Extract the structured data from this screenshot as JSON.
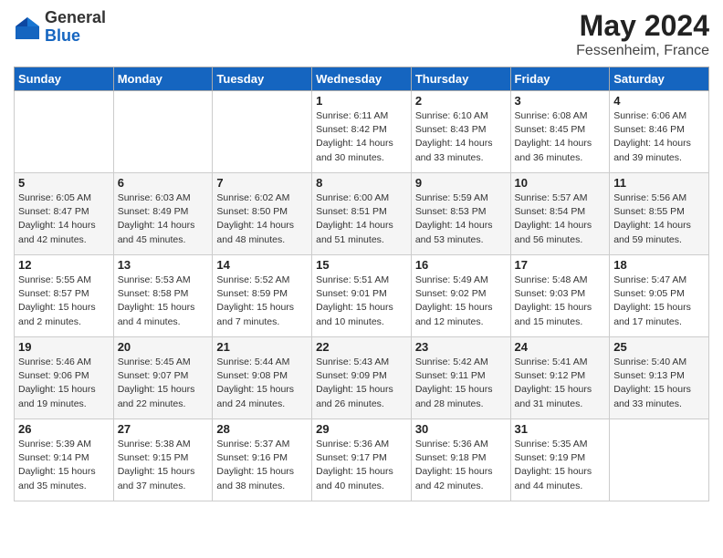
{
  "header": {
    "logo_general": "General",
    "logo_blue": "Blue",
    "month_year": "May 2024",
    "location": "Fessenheim, France"
  },
  "days_of_week": [
    "Sunday",
    "Monday",
    "Tuesday",
    "Wednesday",
    "Thursday",
    "Friday",
    "Saturday"
  ],
  "weeks": [
    [
      {
        "day": "",
        "info": ""
      },
      {
        "day": "",
        "info": ""
      },
      {
        "day": "",
        "info": ""
      },
      {
        "day": "1",
        "info": "Sunrise: 6:11 AM\nSunset: 8:42 PM\nDaylight: 14 hours\nand 30 minutes."
      },
      {
        "day": "2",
        "info": "Sunrise: 6:10 AM\nSunset: 8:43 PM\nDaylight: 14 hours\nand 33 minutes."
      },
      {
        "day": "3",
        "info": "Sunrise: 6:08 AM\nSunset: 8:45 PM\nDaylight: 14 hours\nand 36 minutes."
      },
      {
        "day": "4",
        "info": "Sunrise: 6:06 AM\nSunset: 8:46 PM\nDaylight: 14 hours\nand 39 minutes."
      }
    ],
    [
      {
        "day": "5",
        "info": "Sunrise: 6:05 AM\nSunset: 8:47 PM\nDaylight: 14 hours\nand 42 minutes."
      },
      {
        "day": "6",
        "info": "Sunrise: 6:03 AM\nSunset: 8:49 PM\nDaylight: 14 hours\nand 45 minutes."
      },
      {
        "day": "7",
        "info": "Sunrise: 6:02 AM\nSunset: 8:50 PM\nDaylight: 14 hours\nand 48 minutes."
      },
      {
        "day": "8",
        "info": "Sunrise: 6:00 AM\nSunset: 8:51 PM\nDaylight: 14 hours\nand 51 minutes."
      },
      {
        "day": "9",
        "info": "Sunrise: 5:59 AM\nSunset: 8:53 PM\nDaylight: 14 hours\nand 53 minutes."
      },
      {
        "day": "10",
        "info": "Sunrise: 5:57 AM\nSunset: 8:54 PM\nDaylight: 14 hours\nand 56 minutes."
      },
      {
        "day": "11",
        "info": "Sunrise: 5:56 AM\nSunset: 8:55 PM\nDaylight: 14 hours\nand 59 minutes."
      }
    ],
    [
      {
        "day": "12",
        "info": "Sunrise: 5:55 AM\nSunset: 8:57 PM\nDaylight: 15 hours\nand 2 minutes."
      },
      {
        "day": "13",
        "info": "Sunrise: 5:53 AM\nSunset: 8:58 PM\nDaylight: 15 hours\nand 4 minutes."
      },
      {
        "day": "14",
        "info": "Sunrise: 5:52 AM\nSunset: 8:59 PM\nDaylight: 15 hours\nand 7 minutes."
      },
      {
        "day": "15",
        "info": "Sunrise: 5:51 AM\nSunset: 9:01 PM\nDaylight: 15 hours\nand 10 minutes."
      },
      {
        "day": "16",
        "info": "Sunrise: 5:49 AM\nSunset: 9:02 PM\nDaylight: 15 hours\nand 12 minutes."
      },
      {
        "day": "17",
        "info": "Sunrise: 5:48 AM\nSunset: 9:03 PM\nDaylight: 15 hours\nand 15 minutes."
      },
      {
        "day": "18",
        "info": "Sunrise: 5:47 AM\nSunset: 9:05 PM\nDaylight: 15 hours\nand 17 minutes."
      }
    ],
    [
      {
        "day": "19",
        "info": "Sunrise: 5:46 AM\nSunset: 9:06 PM\nDaylight: 15 hours\nand 19 minutes."
      },
      {
        "day": "20",
        "info": "Sunrise: 5:45 AM\nSunset: 9:07 PM\nDaylight: 15 hours\nand 22 minutes."
      },
      {
        "day": "21",
        "info": "Sunrise: 5:44 AM\nSunset: 9:08 PM\nDaylight: 15 hours\nand 24 minutes."
      },
      {
        "day": "22",
        "info": "Sunrise: 5:43 AM\nSunset: 9:09 PM\nDaylight: 15 hours\nand 26 minutes."
      },
      {
        "day": "23",
        "info": "Sunrise: 5:42 AM\nSunset: 9:11 PM\nDaylight: 15 hours\nand 28 minutes."
      },
      {
        "day": "24",
        "info": "Sunrise: 5:41 AM\nSunset: 9:12 PM\nDaylight: 15 hours\nand 31 minutes."
      },
      {
        "day": "25",
        "info": "Sunrise: 5:40 AM\nSunset: 9:13 PM\nDaylight: 15 hours\nand 33 minutes."
      }
    ],
    [
      {
        "day": "26",
        "info": "Sunrise: 5:39 AM\nSunset: 9:14 PM\nDaylight: 15 hours\nand 35 minutes."
      },
      {
        "day": "27",
        "info": "Sunrise: 5:38 AM\nSunset: 9:15 PM\nDaylight: 15 hours\nand 37 minutes."
      },
      {
        "day": "28",
        "info": "Sunrise: 5:37 AM\nSunset: 9:16 PM\nDaylight: 15 hours\nand 38 minutes."
      },
      {
        "day": "29",
        "info": "Sunrise: 5:36 AM\nSunset: 9:17 PM\nDaylight: 15 hours\nand 40 minutes."
      },
      {
        "day": "30",
        "info": "Sunrise: 5:36 AM\nSunset: 9:18 PM\nDaylight: 15 hours\nand 42 minutes."
      },
      {
        "day": "31",
        "info": "Sunrise: 5:35 AM\nSunset: 9:19 PM\nDaylight: 15 hours\nand 44 minutes."
      },
      {
        "day": "",
        "info": ""
      }
    ]
  ]
}
